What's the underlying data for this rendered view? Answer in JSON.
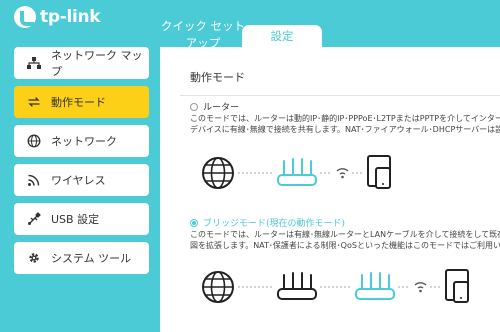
{
  "brand": {
    "name": "tp-link"
  },
  "tabs": {
    "quick_setup": "クイック セット アップ",
    "settings": "設定"
  },
  "sidebar": {
    "items": [
      {
        "label": "ネットワーク マップ",
        "icon": "network-map-icon"
      },
      {
        "label": "動作モード",
        "icon": "operation-mode-icon",
        "active": true
      },
      {
        "label": "ネットワーク",
        "icon": "globe-icon"
      },
      {
        "label": "ワイヤレス",
        "icon": "wireless-icon"
      },
      {
        "label": "USB 設定",
        "icon": "usb-icon"
      },
      {
        "label": "システム ツール",
        "icon": "gear-icon"
      }
    ]
  },
  "main": {
    "section_title": "動作モード",
    "modes": [
      {
        "label": "ルーター",
        "selected": false,
        "desc_line1": "このモードでは、ルーターは動的IP･静的IP･PPPoE･L2TPまたはPPTPを介してインターネ",
        "desc_line2": "デバイスに有線･無線で接続を共有します。NAT･ファイアウォール･DHCPサーバーは設定"
      },
      {
        "label": "ブリッジモード(現在の動作モード)",
        "selected": true,
        "desc_line1": "このモードでは、ルーターは有線･無線ルーターとLANケーブルを介して接続をして既存の",
        "desc_line2": "図を拡張します。NAT･保護者による制限･QoSといった機能はこのモードではご利用いた"
      }
    ]
  },
  "colors": {
    "accent": "#4acbd6",
    "active_nav": "#fcd016"
  }
}
